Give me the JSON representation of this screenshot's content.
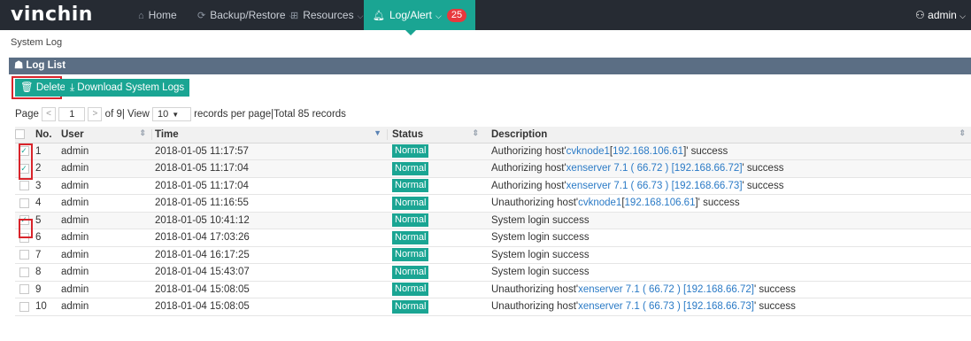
{
  "app": {
    "logo": "vinchin",
    "nav": [
      {
        "label": "Home",
        "icon": "home-icon",
        "glyph": "⌂",
        "chevron": false
      },
      {
        "label": "Backup/Restore",
        "icon": "backup-icon",
        "glyph": "⟳",
        "chevron": true
      },
      {
        "label": "Resources",
        "icon": "resources-icon",
        "glyph": "⊞",
        "chevron": true
      },
      {
        "label": "Log/Alert",
        "icon": "bell-icon",
        "glyph": "♫",
        "chevron": true,
        "badge": "25",
        "active": true
      }
    ],
    "user": "admin"
  },
  "breadcrumb": "System Log",
  "panel": {
    "title": "Log List"
  },
  "toolbar": {
    "delete_label": "Delete",
    "download_label": "Download System Logs"
  },
  "pager": {
    "page_label": "Page",
    "current_page": "1",
    "of_label": "of 9| View",
    "per_page": "10",
    "records_label": "records per page|Total 85 records"
  },
  "table": {
    "headers": {
      "no": "No.",
      "user": "User",
      "time": "Time",
      "status": "Status",
      "description": "Description"
    },
    "rows": [
      {
        "no": "1",
        "user": "admin",
        "time": "2018-01-05 11:17:57",
        "status": "Normal",
        "checked": true,
        "desc": [
          {
            "t": "Authorizing host'"
          },
          {
            "t": "cvknode1",
            "link": true
          },
          {
            "t": "["
          },
          {
            "t": "192.168.106.61",
            "link": true
          },
          {
            "t": "]' success"
          }
        ]
      },
      {
        "no": "2",
        "user": "admin",
        "time": "2018-01-05 11:17:04",
        "status": "Normal",
        "checked": true,
        "desc": [
          {
            "t": "Authorizing host'"
          },
          {
            "t": "xenserver 7.1 ( 66.72 )",
            "link": true
          },
          {
            "t": " "
          },
          {
            "t": "[192.168.66.72]",
            "link": true
          },
          {
            "t": "' success"
          }
        ]
      },
      {
        "no": "3",
        "user": "admin",
        "time": "2018-01-05 11:17:04",
        "status": "Normal",
        "checked": false,
        "desc": [
          {
            "t": "Authorizing host'"
          },
          {
            "t": "xenserver 7.1 ( 66.73 )",
            "link": true
          },
          {
            "t": " "
          },
          {
            "t": "[192.168.66.73]",
            "link": true
          },
          {
            "t": "' success"
          }
        ]
      },
      {
        "no": "4",
        "user": "admin",
        "time": "2018-01-05 11:16:55",
        "status": "Normal",
        "checked": false,
        "desc": [
          {
            "t": "Unauthorizing host'"
          },
          {
            "t": "cvknode1",
            "link": true
          },
          {
            "t": "["
          },
          {
            "t": "192.168.106.61",
            "link": true
          },
          {
            "t": "]' success"
          }
        ]
      },
      {
        "no": "5",
        "user": "admin",
        "time": "2018-01-05 10:41:12",
        "status": "Normal",
        "checked": true,
        "desc": [
          {
            "t": "System login success"
          }
        ]
      },
      {
        "no": "6",
        "user": "admin",
        "time": "2018-01-04 17:03:26",
        "status": "Normal",
        "checked": false,
        "desc": [
          {
            "t": "System login success"
          }
        ]
      },
      {
        "no": "7",
        "user": "admin",
        "time": "2018-01-04 16:17:25",
        "status": "Normal",
        "checked": false,
        "desc": [
          {
            "t": "System login success"
          }
        ]
      },
      {
        "no": "8",
        "user": "admin",
        "time": "2018-01-04 15:43:07",
        "status": "Normal",
        "checked": false,
        "desc": [
          {
            "t": "System login success"
          }
        ]
      },
      {
        "no": "9",
        "user": "admin",
        "time": "2018-01-04 15:08:05",
        "status": "Normal",
        "checked": false,
        "desc": [
          {
            "t": "Unauthorizing host'"
          },
          {
            "t": "xenserver 7.1 ( 66.72 )",
            "link": true
          },
          {
            "t": " "
          },
          {
            "t": "[192.168.66.72]",
            "link": true
          },
          {
            "t": "' success"
          }
        ]
      },
      {
        "no": "10",
        "user": "admin",
        "time": "2018-01-04 15:08:05",
        "status": "Normal",
        "checked": false,
        "desc": [
          {
            "t": "Unauthorizing host'"
          },
          {
            "t": "xenserver 7.1 ( 66.73 )",
            "link": true
          },
          {
            "t": " "
          },
          {
            "t": "[192.168.66.73]",
            "link": true
          },
          {
            "t": "' success"
          }
        ]
      }
    ]
  },
  "colors": {
    "accent": "#1aa593",
    "topbar": "#262b33",
    "panel_header": "#5b6e84",
    "highlight": "#d9242b",
    "link": "#2a7ac6",
    "badge": "#e8383d"
  }
}
